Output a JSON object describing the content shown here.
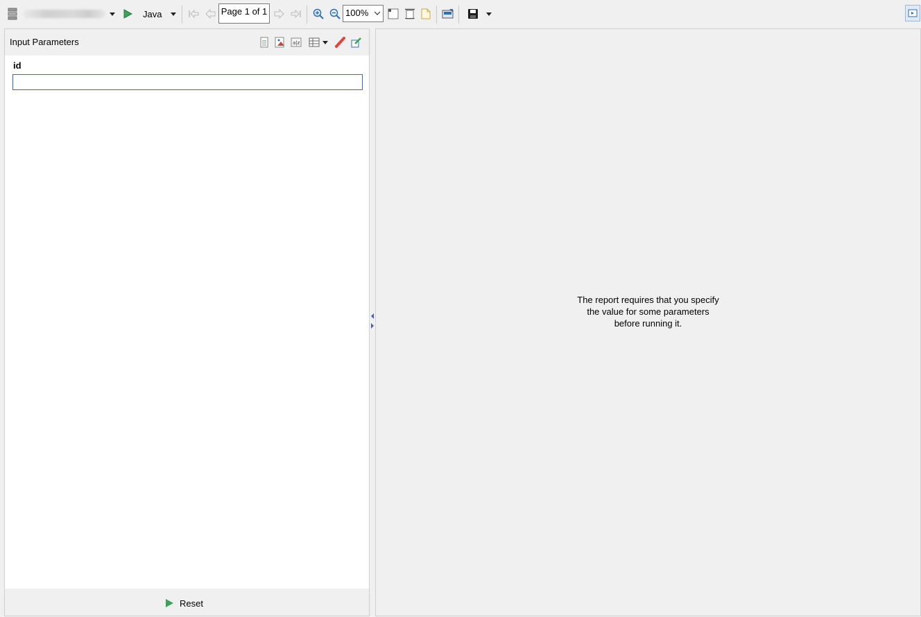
{
  "toolbar": {
    "run_target": "Java",
    "page_indicator": "Page 1 of 1",
    "zoom": "100%",
    "icons": [
      "database-icon",
      "dropdown-icon",
      "run-icon",
      "run-config-dropdown-icon",
      "first-page-icon",
      "previous-page-icon",
      "next-page-icon",
      "last-page-icon",
      "zoom-in-icon",
      "zoom-out-icon",
      "fit-whole-page-icon",
      "fit-page-width-icon",
      "actual-size-icon",
      "export-icon",
      "save-icon",
      "save-dropdown-icon",
      "maximize-icon"
    ]
  },
  "parameters_panel": {
    "title": "Input Parameters",
    "header_icons": [
      "collapse-all-icon",
      "image-icon",
      "sort-az-icon",
      "layout-icon",
      "layout-dropdown-icon",
      "clear-icon",
      "edit-icon"
    ],
    "fields": [
      {
        "label": "id",
        "value": "",
        "placeholder": ""
      }
    ],
    "reset_label": "Reset"
  },
  "report_panel": {
    "message_lines": [
      "The report requires that you specify",
      "the value for some parameters",
      "before running it."
    ]
  },
  "colors": {
    "accent_green": "#3aa35a",
    "input_border": "#2a6fb8",
    "background": "#f0f0f0"
  }
}
